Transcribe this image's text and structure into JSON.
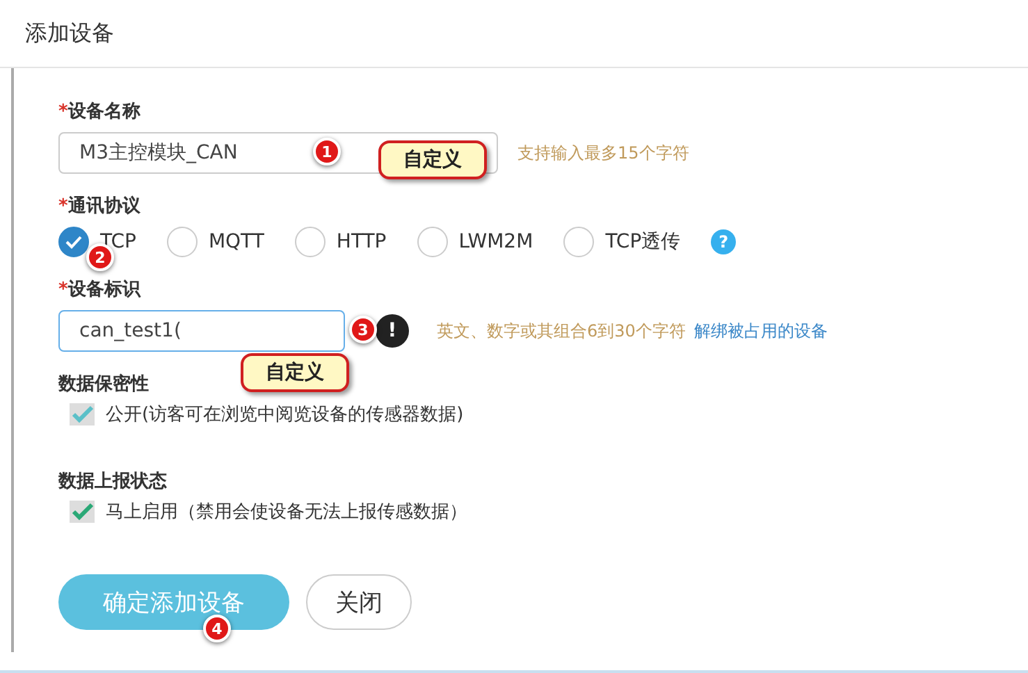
{
  "dialog": {
    "title": "添加设备"
  },
  "name_field": {
    "required_mark": "*",
    "label": "设备名称",
    "value": "M3主控模块_CAN",
    "hint": "支持输入最多15个字符"
  },
  "protocol": {
    "required_mark": "*",
    "label": "通讯协议",
    "options": [
      {
        "label": "TCP",
        "selected": true
      },
      {
        "label": "MQTT",
        "selected": false
      },
      {
        "label": "HTTP",
        "selected": false
      },
      {
        "label": "LWM2M",
        "selected": false
      },
      {
        "label": "TCP透传",
        "selected": false
      }
    ],
    "help": "?"
  },
  "id_field": {
    "required_mark": "*",
    "label": "设备标识",
    "value": "can_test1(",
    "alert": "!",
    "hint": "英文、数字或其组合6到30个字符",
    "link": "解绑被占用的设备"
  },
  "privacy": {
    "label": "数据保密性",
    "option": {
      "label": "公开(访客可在浏览中阅览设备的传感器数据)",
      "checked": true
    }
  },
  "report": {
    "label": "数据上报状态",
    "option": {
      "label": "马上启用（禁用会使设备无法上报传感数据）",
      "checked": true
    }
  },
  "buttons": [
    {
      "label": "确定添加设备",
      "kind": "primary"
    },
    {
      "label": "关闭",
      "kind": "secondary"
    }
  ],
  "annotations": {
    "markers": [
      "1",
      "2",
      "3",
      "4"
    ],
    "callouts": [
      "自定义",
      "自定义"
    ]
  }
}
